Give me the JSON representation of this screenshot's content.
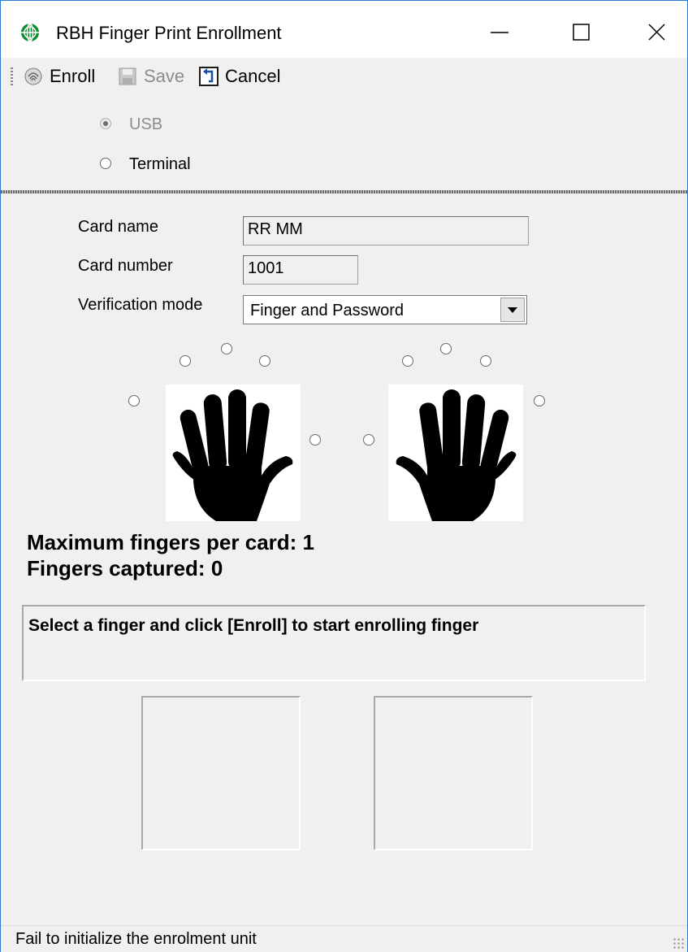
{
  "window": {
    "title": "RBH Finger Print Enrollment",
    "icon": "globe-icon",
    "controls": [
      "minimize-icon",
      "maximize-icon",
      "close-icon"
    ]
  },
  "toolbar": {
    "enroll_label": "Enroll",
    "save_label": "Save",
    "cancel_label": "Cancel",
    "save_enabled": false
  },
  "connection": {
    "options": [
      {
        "label": "USB",
        "checked": true,
        "enabled": false
      },
      {
        "label": "Terminal",
        "checked": false,
        "enabled": true
      }
    ]
  },
  "form": {
    "card_name_label": "Card name",
    "card_name_value": "RR MM",
    "card_number_label": "Card number",
    "card_number_value": "1001",
    "verification_mode_label": "Verification mode",
    "verification_mode_value": "Finger and Password"
  },
  "fingers": {
    "left_hand_icon": "left-hand-icon",
    "right_hand_icon": "right-hand-icon",
    "selected": null
  },
  "summary": {
    "max_fingers": "Maximum fingers per card: 1",
    "captured": "Fingers captured: 0"
  },
  "message": "Select a finger and click [Enroll] to start enrolling finger",
  "status": {
    "text": "Fail to initialize the enrolment unit"
  },
  "colors": {
    "window_border": "#2b79d8",
    "icon_green": "#0d8c2d",
    "cancel_icon_blue": "#1b4ea8"
  }
}
